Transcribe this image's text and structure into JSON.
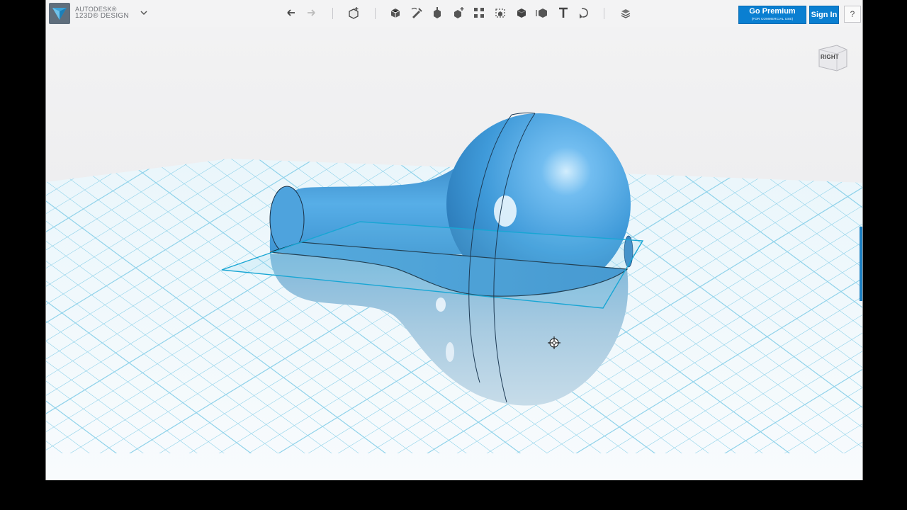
{
  "app": {
    "brand_line1": "AUTODESK®",
    "brand_line2": "123D® DESIGN"
  },
  "toolbar": {
    "tools": [
      "undo-icon",
      "redo-icon",
      "new-object-icon",
      "primitives-icon",
      "sketch-icon",
      "construct-icon",
      "modify-icon",
      "pattern-icon",
      "grouping-icon",
      "combine-icon",
      "measure-icon",
      "text-icon",
      "snap-icon",
      "material-icon"
    ]
  },
  "account": {
    "premium_label": "Go Premium",
    "premium_sub": "(FOR COMMERCIAL USE)",
    "signin_label": "Sign In",
    "help_label": "?"
  },
  "viewcube": {
    "face_label": "RIGHT"
  },
  "colors": {
    "accent": "#0a7fd1",
    "model": "#4ea6e3",
    "grid": "#8fd2ea"
  }
}
